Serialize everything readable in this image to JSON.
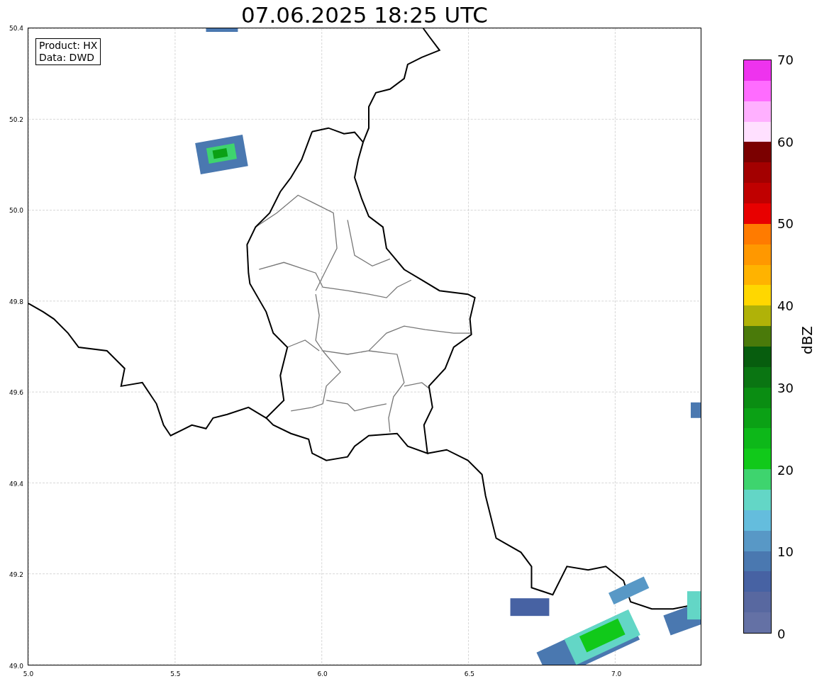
{
  "title": "07.06.2025 18:25 UTC",
  "info_box": [
    "Product: HX",
    "Data: DWD"
  ],
  "map": {
    "xticks": [
      "5.0",
      "5.5",
      "6.0",
      "6.5",
      "7.0"
    ],
    "yticks": [
      "50.4",
      "50.2",
      "50.0",
      "49.8",
      "49.6",
      "49.4",
      "49.2",
      "49.0"
    ]
  },
  "colorbar": {
    "label": "dBZ",
    "ticks": [
      "70",
      "60",
      "50",
      "40",
      "30",
      "20",
      "10",
      "0"
    ],
    "bands": [
      {
        "color": "#6471a5"
      },
      {
        "color": "#5868a0"
      },
      {
        "color": "#4762a3"
      },
      {
        "color": "#4a78b0"
      },
      {
        "color": "#5898c6"
      },
      {
        "color": "#64bddd"
      },
      {
        "color": "#63d6c6"
      },
      {
        "color": "#3ed46e"
      },
      {
        "color": "#11c91a"
      },
      {
        "color": "#0db819"
      },
      {
        "color": "#0ba115"
      },
      {
        "color": "#0a8d12"
      },
      {
        "color": "#0a7512"
      },
      {
        "color": "#075d0e"
      },
      {
        "color": "#4a7a0a"
      },
      {
        "color": "#b0b208"
      },
      {
        "color": "#ffd700"
      },
      {
        "color": "#ffb300"
      },
      {
        "color": "#ff9800"
      },
      {
        "color": "#ff7b00"
      },
      {
        "color": "#e80000"
      },
      {
        "color": "#c00000"
      },
      {
        "color": "#a30000"
      },
      {
        "color": "#7b0000"
      },
      {
        "color": "#ffe0ff"
      },
      {
        "color": "#ffb0ff"
      },
      {
        "color": "#ff6cff"
      },
      {
        "color": "#ee33ee"
      }
    ]
  }
}
